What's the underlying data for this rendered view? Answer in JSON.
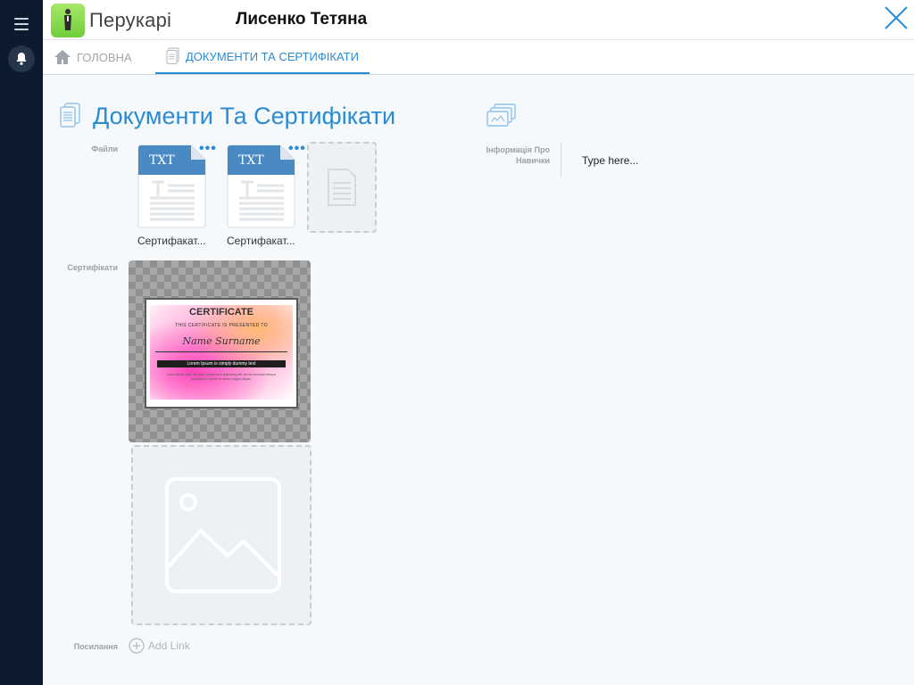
{
  "app": {
    "name": "Перукарі",
    "user_name": "Лисенко Тетяна"
  },
  "tabs": [
    {
      "label": "ГОЛОВНА",
      "icon": "home-icon",
      "active": false
    },
    {
      "label": "ДОКУМЕНТИ ТА СЕРТИФІКАТИ",
      "icon": "documents-icon",
      "active": true
    }
  ],
  "section": {
    "title": "Документи Та Сертифікати"
  },
  "files": {
    "label": "Файли",
    "items": [
      {
        "type": "TXT",
        "name": "Сертифакат...",
        "menu": "•••"
      },
      {
        "type": "TXT",
        "name": "Сертифакат...",
        "menu": "•••"
      }
    ]
  },
  "certificates": {
    "label": "Сертифікати",
    "preview": {
      "title": "CERTIFICATE",
      "subtitle": "THIS CERTIFICATE IS PRESENTED TO",
      "name": "Name Surname",
      "ribbon": "Lorem Ipsum is simply dummy text",
      "body": "Lorem ipsum dolor sit amet, consectetur adipiscing elit, sed do eiusmod tempor incididunt ut labore et dolore magna aliqua."
    }
  },
  "links": {
    "label": "Посилання",
    "add_label": "Add Link"
  },
  "skills": {
    "label": "Інформація Про Навички",
    "placeholder": "Type here..."
  },
  "colors": {
    "accent": "#2a8bd5",
    "sidebar": "#0c1b2e",
    "file_badge": "#4a8ac4"
  }
}
